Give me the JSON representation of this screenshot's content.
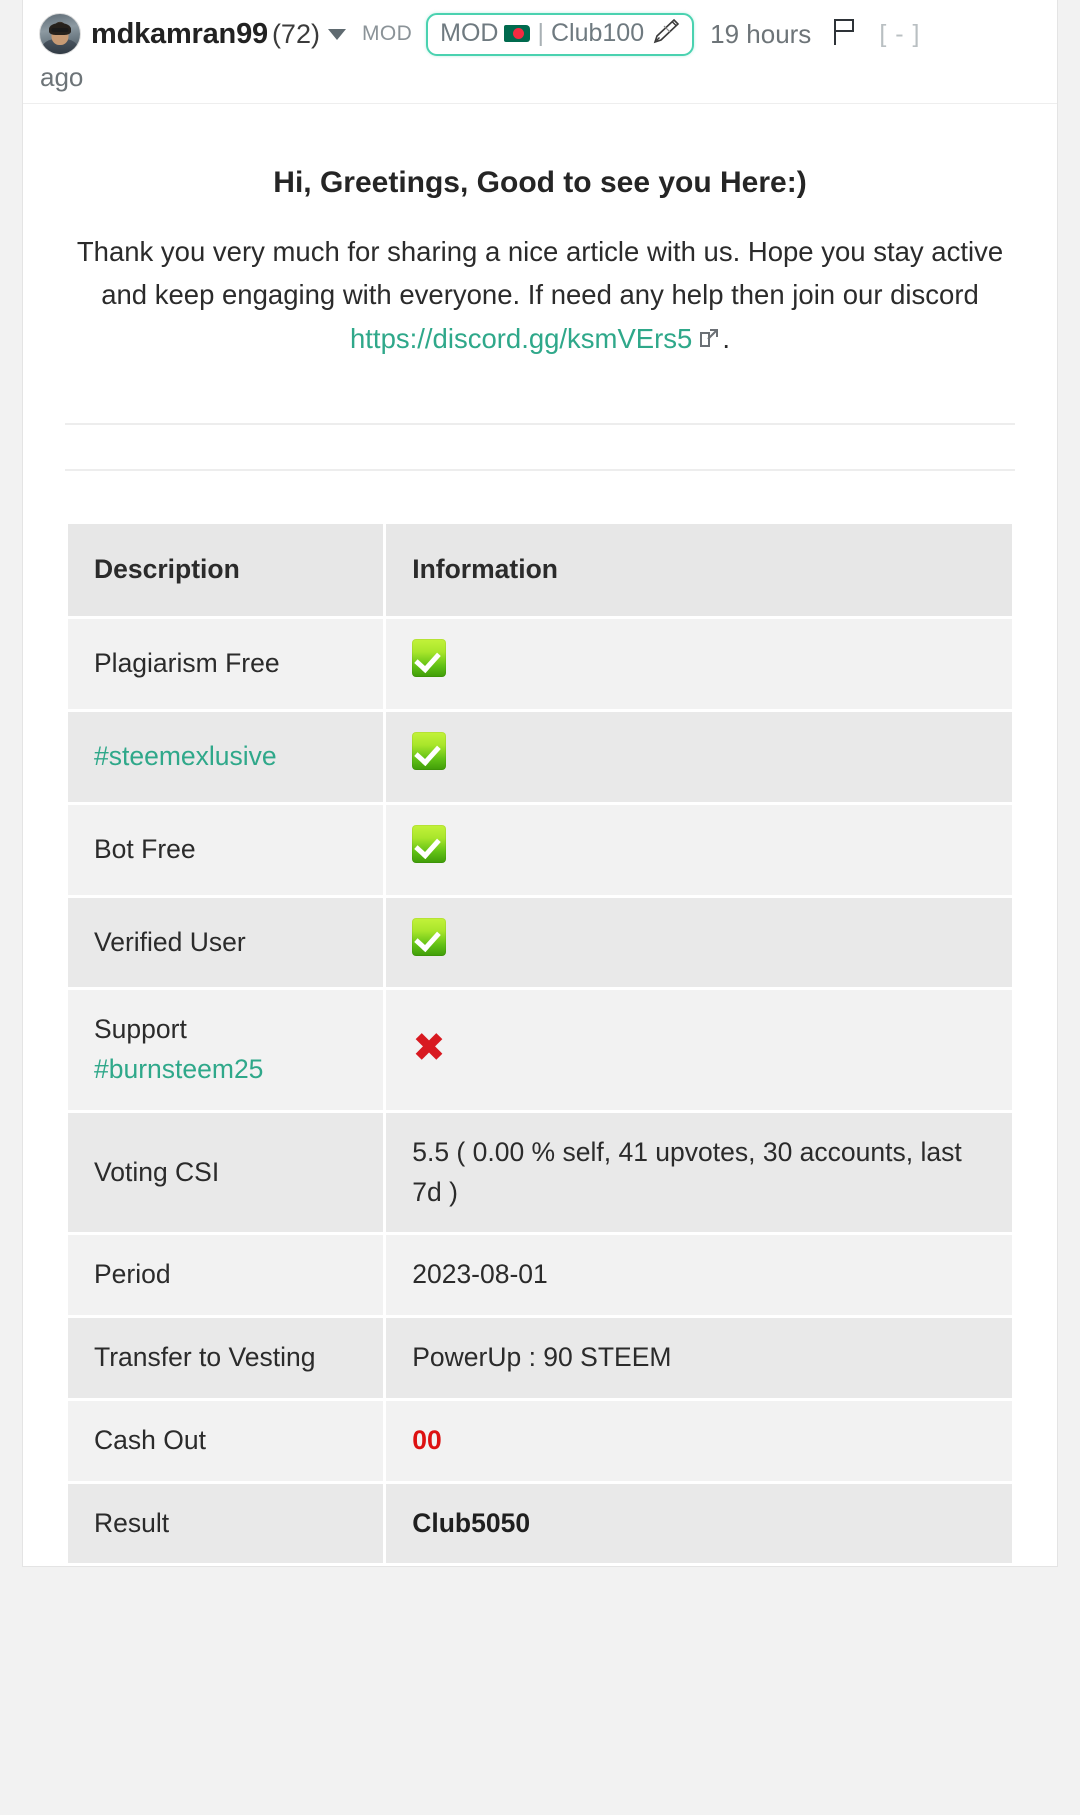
{
  "header": {
    "avatar_name": "user-avatar",
    "author": "mdkamran99",
    "reputation": "(72)",
    "mod_label": "MOD",
    "badge": {
      "role": "MOD",
      "flag_icon": "bangladesh-flag-icon",
      "separator": "|",
      "club": "Club100",
      "pen_icon": "pen-icon"
    },
    "timestamp": "19 hours",
    "timestamp_wrap": "ago",
    "flag_icon": "flag-outline-icon",
    "collapse": "[ - ]"
  },
  "post": {
    "title": "Hi, Greetings, Good to see you Here:)",
    "paragraph_before": "Thank you very much for sharing a nice article with us. Hope you stay active and keep engaging with everyone. If need any help then join our discord ",
    "link_text": "https://discord.gg/ksmVErs5",
    "paragraph_after": "."
  },
  "table": {
    "headers": [
      "Description",
      "Information"
    ],
    "rows": [
      {
        "description": "Plagiarism Free",
        "value": "",
        "value_type": "tick",
        "desc_link": false
      },
      {
        "description": "#steemexlusive",
        "value": "",
        "value_type": "tick",
        "desc_link": true
      },
      {
        "description": "Bot Free",
        "value": "",
        "value_type": "tick",
        "desc_link": false
      },
      {
        "description": "Verified User",
        "value": "",
        "value_type": "tick",
        "desc_link": false
      },
      {
        "description": "Support",
        "description2": "#burnsteem25",
        "value": "",
        "value_type": "cross",
        "desc_link": false,
        "desc2_link": true
      },
      {
        "description": "Voting CSI",
        "value": "5.5 ( 0.00 % self, 41 upvotes, 30 accounts, last 7d )",
        "value_type": "text",
        "desc_link": false
      },
      {
        "description": "Period",
        "value": "2023-08-01",
        "value_type": "text",
        "desc_link": false
      },
      {
        "description": "Transfer to Vesting",
        "value": "PowerUp : 90 STEEM",
        "value_type": "text",
        "desc_link": false
      },
      {
        "description": "Cash Out",
        "value": "00",
        "value_type": "text-red",
        "desc_link": false
      },
      {
        "description": "Result",
        "value": "Club5050",
        "value_type": "text-bold",
        "desc_link": false
      }
    ]
  },
  "colors": {
    "link": "#2fa88a",
    "badge_border": "#4ad2b0",
    "tick_green": "#5fbf14",
    "cross_red": "#d81920",
    "value_red": "#dd1111",
    "page_bg": "#f2f2f2",
    "card_bg": "#ffffff",
    "row_odd": "#f2f2f2",
    "row_even": "#e9e9e9",
    "header_row": "#e7e7e7"
  }
}
